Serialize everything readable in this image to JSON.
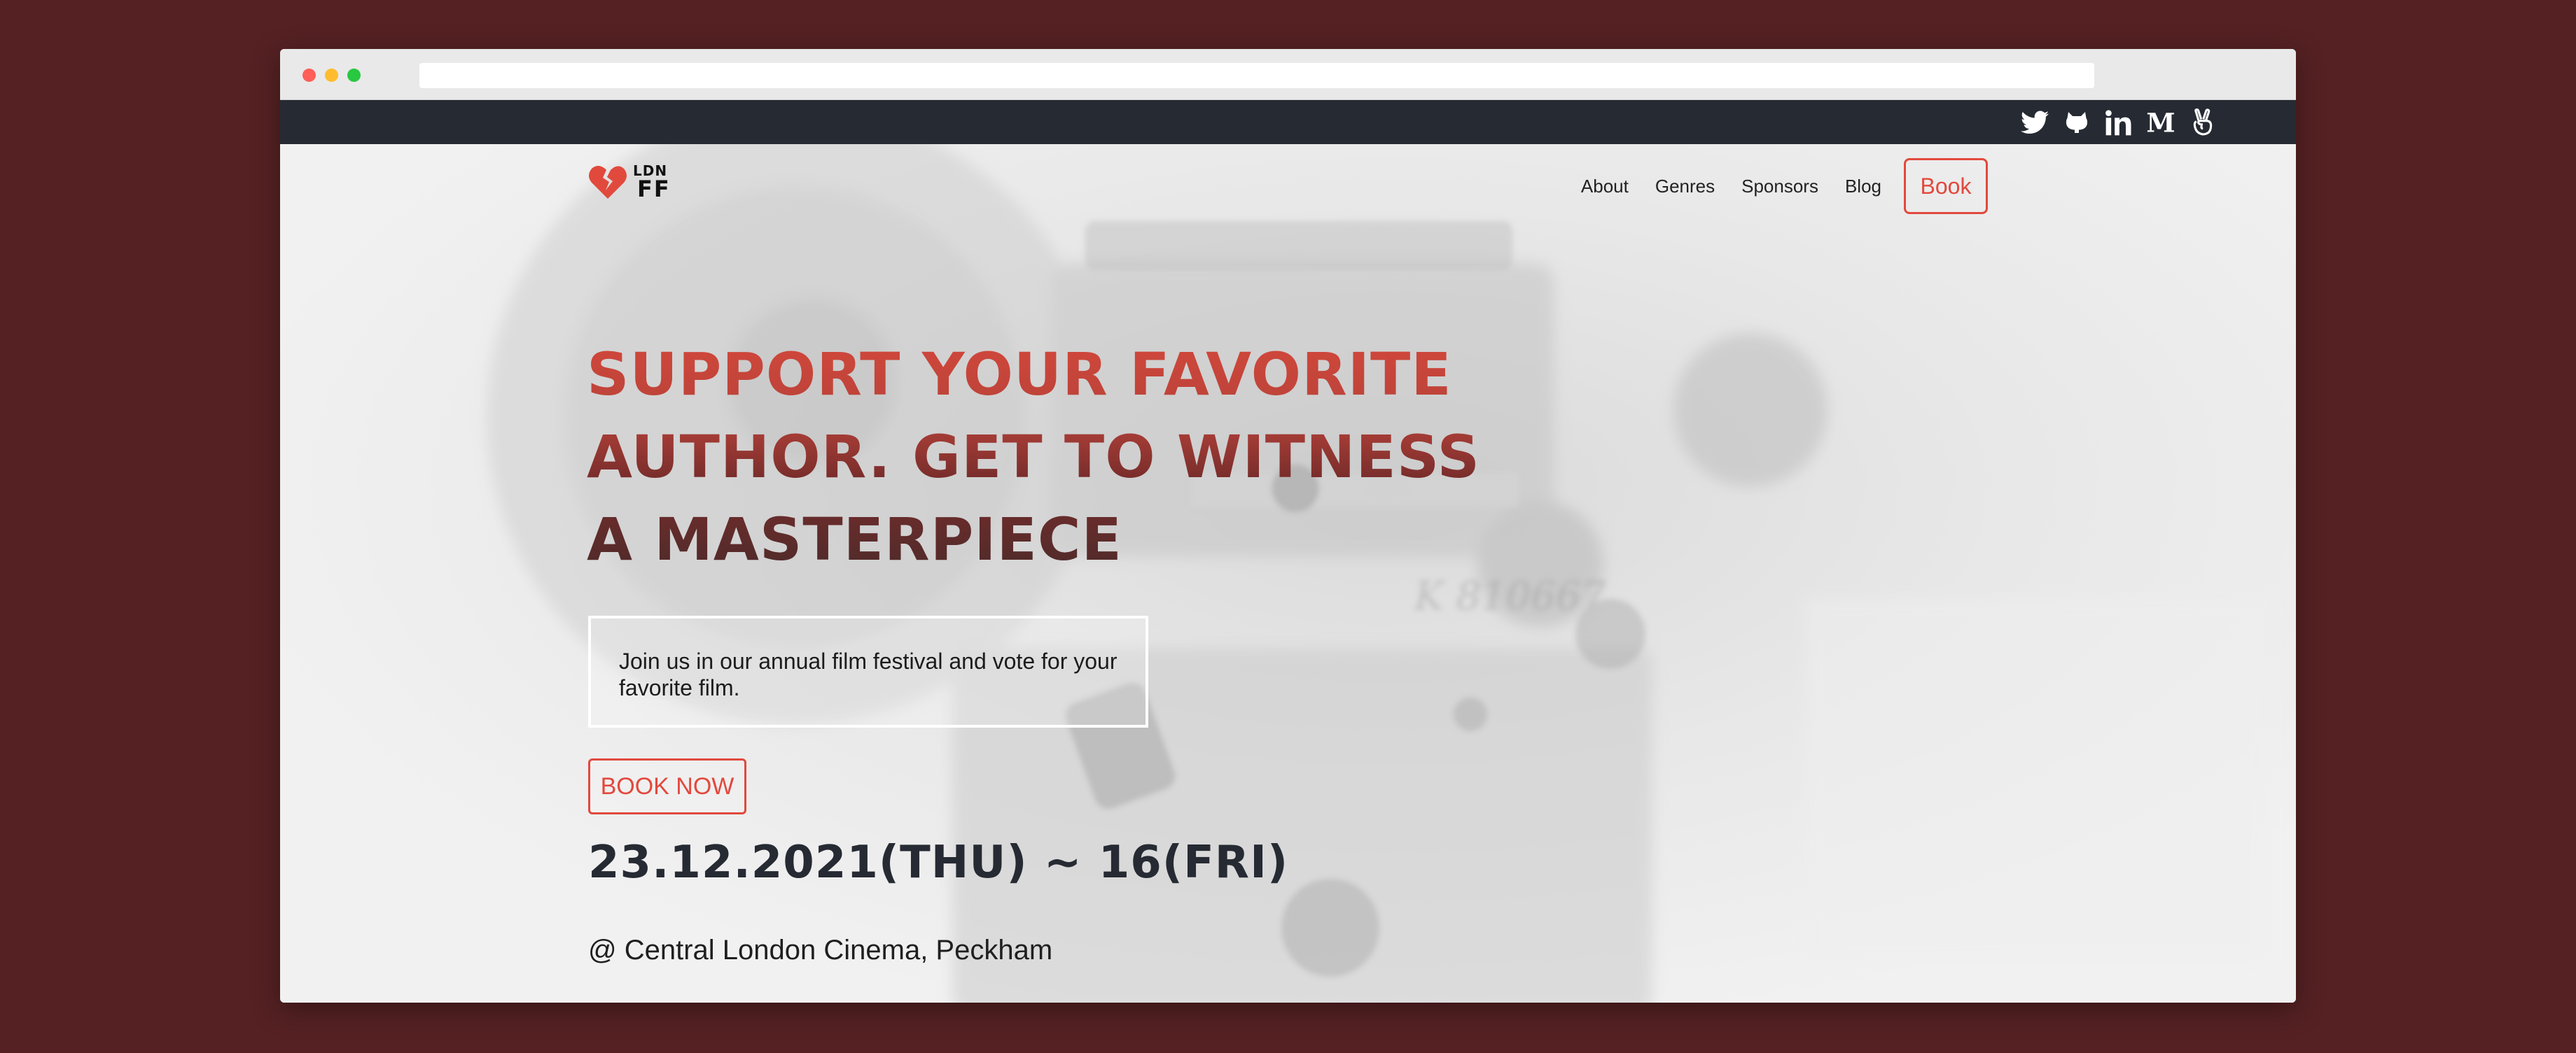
{
  "social": {
    "icons": [
      "twitter-icon",
      "github-icon",
      "linkedin-icon",
      "medium-icon",
      "angellist-icon"
    ]
  },
  "logo": {
    "top": "LDN",
    "bottom": "FF",
    "icon": "broken-heart-icon",
    "color": "#e2493d"
  },
  "nav": {
    "items": [
      "About",
      "Genres",
      "Sponsors",
      "Blog"
    ],
    "book_label": "Book"
  },
  "hero": {
    "headline": [
      "SUPPORT YOUR FAVORITE",
      "AUTHOR. GET TO WITNESS",
      "A MASTERPIECE"
    ],
    "intro": "Join us in our annual film festival and vote for your favorite film.",
    "cta_label": "BOOK NOW",
    "date": "23.12.2021(THU) ~ 16(FRI)",
    "venue": "@ Central London Cinema, Peckham"
  },
  "colors": {
    "page_background": "#552123",
    "accent": "#e2493d",
    "dark": "#262a33"
  }
}
